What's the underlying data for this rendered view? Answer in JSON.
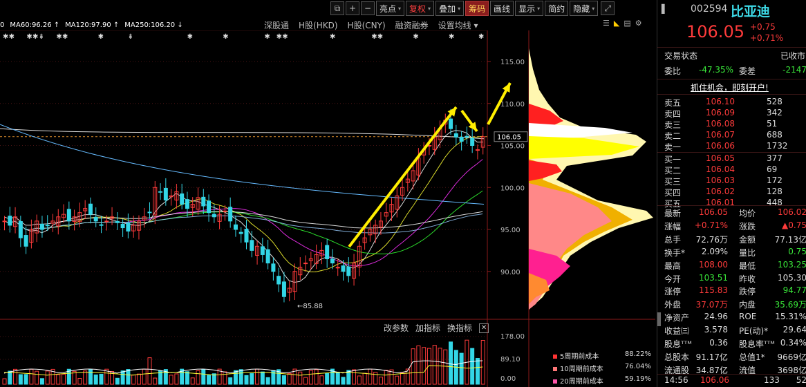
{
  "toolbar": {
    "buttons": [
      {
        "label": "亮点",
        "dropdown": true
      },
      {
        "label": "复权",
        "dropdown": true,
        "highlight": "red-text"
      },
      {
        "label": "叠加",
        "dropdown": true
      },
      {
        "label": "筹码",
        "dropdown": false,
        "active": true
      },
      {
        "label": "画线",
        "dropdown": false
      },
      {
        "label": "显示",
        "dropdown": true
      },
      {
        "label": "简约",
        "dropdown": false
      },
      {
        "label": "隐藏",
        "dropdown": true
      }
    ]
  },
  "ma_legend": [
    {
      "text": "0",
      "color": "#ffffff"
    },
    {
      "text": "MA60:96.26 ↑",
      "color": "#ffffff"
    },
    {
      "text": "MA120:97.90 ↑",
      "color": "#ffffff"
    },
    {
      "text": "MA250:106.20 ↓",
      "color": "#ffffff"
    }
  ],
  "subtabs": [
    "深股通",
    "H股(HKD)",
    "H股(CNY)",
    "融资融券",
    "设置均线 ▾"
  ],
  "price_axis": {
    "ticks": [
      "115.00",
      "110.00",
      "105.00",
      "100.00",
      "95.00",
      "90.00"
    ],
    "current": "106.05"
  },
  "annotations": {
    "low_price": "←85.88"
  },
  "volume_axis": {
    "ticks": [
      "178.00",
      "89.10",
      "0.00"
    ]
  },
  "volume_controls": {
    "modify": "改参数",
    "add": "加指标",
    "switch": "换指标",
    "close": "✕"
  },
  "cost_legend": [
    {
      "label": "5周期前成本",
      "pct": "88.22%",
      "color": "#ff3333"
    },
    {
      "label": "10周期前成本",
      "pct": "76.04%",
      "color": "#ff7777"
    },
    {
      "label": "20周期前成本",
      "pct": "59.19%",
      "color": "#ff55aa"
    }
  ],
  "stock": {
    "code": "002594",
    "name": "比亚迪",
    "price": "106.05",
    "change": "+0.75",
    "change_pct": "+0.71%"
  },
  "status": {
    "label": "交易状态",
    "value": "已收市"
  },
  "ratio": {
    "weibi_label": "委比",
    "weibi": "-47.35%",
    "weicha_label": "委差",
    "weicha": "-2147"
  },
  "promo": "抓住机会，即刻开户!",
  "asks": [
    {
      "label": "卖五",
      "price": "106.10",
      "vol": "528"
    },
    {
      "label": "卖四",
      "price": "106.09",
      "vol": "342"
    },
    {
      "label": "卖三",
      "price": "106.08",
      "vol": "51"
    },
    {
      "label": "卖二",
      "price": "106.07",
      "vol": "688"
    },
    {
      "label": "卖一",
      "price": "106.06",
      "vol": "1732"
    }
  ],
  "bids": [
    {
      "label": "买一",
      "price": "106.05",
      "vol": "377"
    },
    {
      "label": "买二",
      "price": "106.04",
      "vol": "69"
    },
    {
      "label": "买三",
      "price": "106.03",
      "vol": "172"
    },
    {
      "label": "买四",
      "price": "106.02",
      "vol": "128"
    },
    {
      "label": "买五",
      "price": "106.01",
      "vol": "448"
    }
  ],
  "quote_rows": [
    {
      "l1": "最新",
      "v1": "106.05",
      "c1": "red",
      "l2": "均价",
      "v2": "106.02",
      "c2": "red"
    },
    {
      "l1": "涨幅",
      "v1": "+0.71%",
      "c1": "red",
      "l2": "涨跌",
      "v2": "▲0.75",
      "c2": "red"
    },
    {
      "l1": "总手",
      "v1": "72.76万",
      "c1": "white",
      "l2": "金额",
      "v2": "77.13亿",
      "c2": "white"
    },
    {
      "l1": "换手*",
      "v1": "2.09%",
      "c1": "white",
      "l2": "量比",
      "v2": "0.75",
      "c2": "green"
    },
    {
      "l1": "最高",
      "v1": "108.00",
      "c1": "red",
      "l2": "最低",
      "v2": "103.25",
      "c2": "green"
    },
    {
      "l1": "今开",
      "v1": "103.51",
      "c1": "green",
      "l2": "昨收",
      "v2": "105.30",
      "c2": "white"
    },
    {
      "l1": "涨停",
      "v1": "115.83",
      "c1": "red",
      "l2": "跌停",
      "v2": "94.77",
      "c2": "green"
    },
    {
      "l1": "外盘",
      "v1": "37.07万",
      "c1": "red",
      "l2": "内盘",
      "v2": "35.69万",
      "c2": "green"
    },
    {
      "l1": "净资产",
      "v1": "24.96",
      "c1": "white",
      "l2": "ROE",
      "v2": "15.31%",
      "c2": "white"
    },
    {
      "l1": "收益㈢",
      "v1": "3.578",
      "c1": "white",
      "l2": "PE(动)*",
      "v2": "29.64",
      "c2": "white"
    },
    {
      "l1": "股息ᵀᵀᴹ",
      "v1": "0.36",
      "c1": "white",
      "l2": "股息率ᵀᵀᴹ",
      "v2": "0.34%",
      "c2": "white"
    },
    {
      "l1": "总股本",
      "v1": "91.17亿",
      "c1": "white",
      "l2": "总值1*",
      "v2": "9669亿",
      "c2": "white"
    },
    {
      "l1": "流通股",
      "v1": "34.87亿",
      "c1": "white",
      "l2": "流值",
      "v2": "3698亿",
      "c2": "white"
    }
  ],
  "tick": {
    "time": "14:56",
    "price": "106.06",
    "vol": "133",
    "num": "52"
  }
}
